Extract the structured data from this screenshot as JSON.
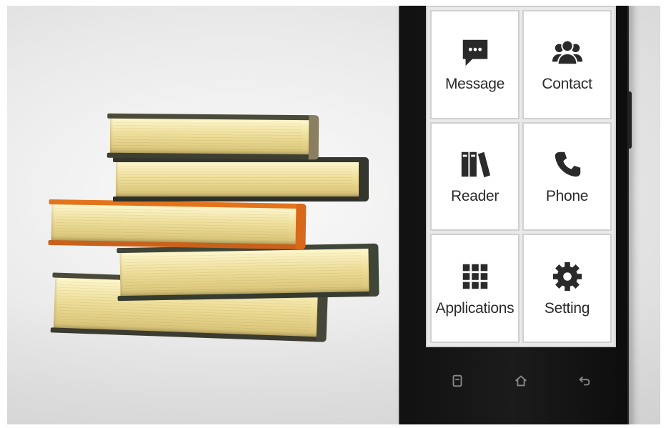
{
  "phone": {
    "tiles": [
      {
        "label": "Message",
        "icon": "message-icon"
      },
      {
        "label": "Contact",
        "icon": "contacts-icon"
      },
      {
        "label": "Reader",
        "icon": "books-icon"
      },
      {
        "label": "Phone",
        "icon": "phone-icon"
      },
      {
        "label": "Applications",
        "icon": "grid-icon"
      },
      {
        "label": "Setting",
        "icon": "gear-icon"
      }
    ],
    "nav_buttons": [
      "menu-icon",
      "home-icon",
      "back-icon"
    ]
  },
  "colors": {
    "tile_icon": "#2a2a2a",
    "phone_body": "#111111",
    "book_pages": "#efdf9a",
    "book_cover_dark": "#3f4638",
    "book_cover_orange": "#e3741c"
  }
}
